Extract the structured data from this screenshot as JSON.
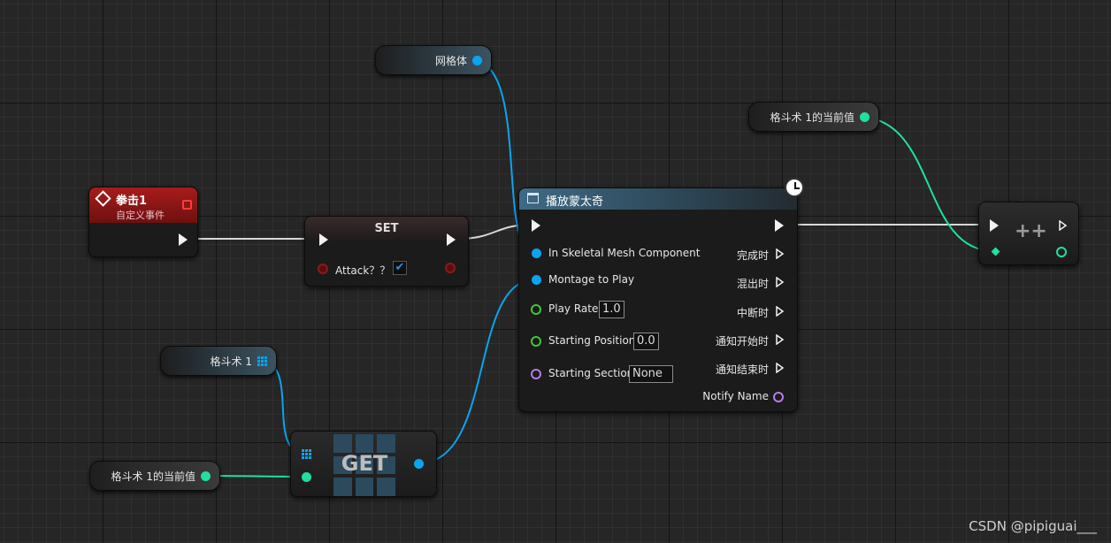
{
  "watermark": "CSDN @pipiguai___",
  "colors": {
    "exec": "#f2f2f2",
    "object_pin": "#0aa4f0",
    "int_pin": "#1fe0a0",
    "float_pin": "#3ec73e",
    "name_pin": "#b67be6",
    "bool_pin": "#8b1a1a",
    "event_header": "#8a1414"
  },
  "nodes": {
    "event": {
      "title": "拳击1",
      "subtitle": "自定义事件",
      "icon": "diamond-event-icon"
    },
    "set": {
      "title": "SET",
      "var_label": "Attack？？",
      "checked": true
    },
    "mesh_var": {
      "label": "网格体"
    },
    "counter_var_top": {
      "label": "格斗术 1的当前值"
    },
    "array_var": {
      "label": "格斗术 1"
    },
    "counter_var_bottom": {
      "label": "格斗术 1的当前值"
    },
    "get": {
      "title": "GET"
    },
    "increment": {
      "title": "++"
    },
    "montage": {
      "title": "播放蒙太奇",
      "inputs": {
        "mesh": "In Skeletal Mesh Component",
        "montage": "Montage to Play",
        "rate": "Play Rate",
        "rate_value": "1.0",
        "start_pos": "Starting Position",
        "start_pos_value": "0.0",
        "section": "Starting Section",
        "section_value": "None"
      },
      "outputs": {
        "completed": "完成时",
        "blend_out": "混出时",
        "interrupted": "中断时",
        "notify_begin": "通知开始时",
        "notify_end": "通知结束时",
        "notify_name": "Notify Name"
      }
    }
  }
}
